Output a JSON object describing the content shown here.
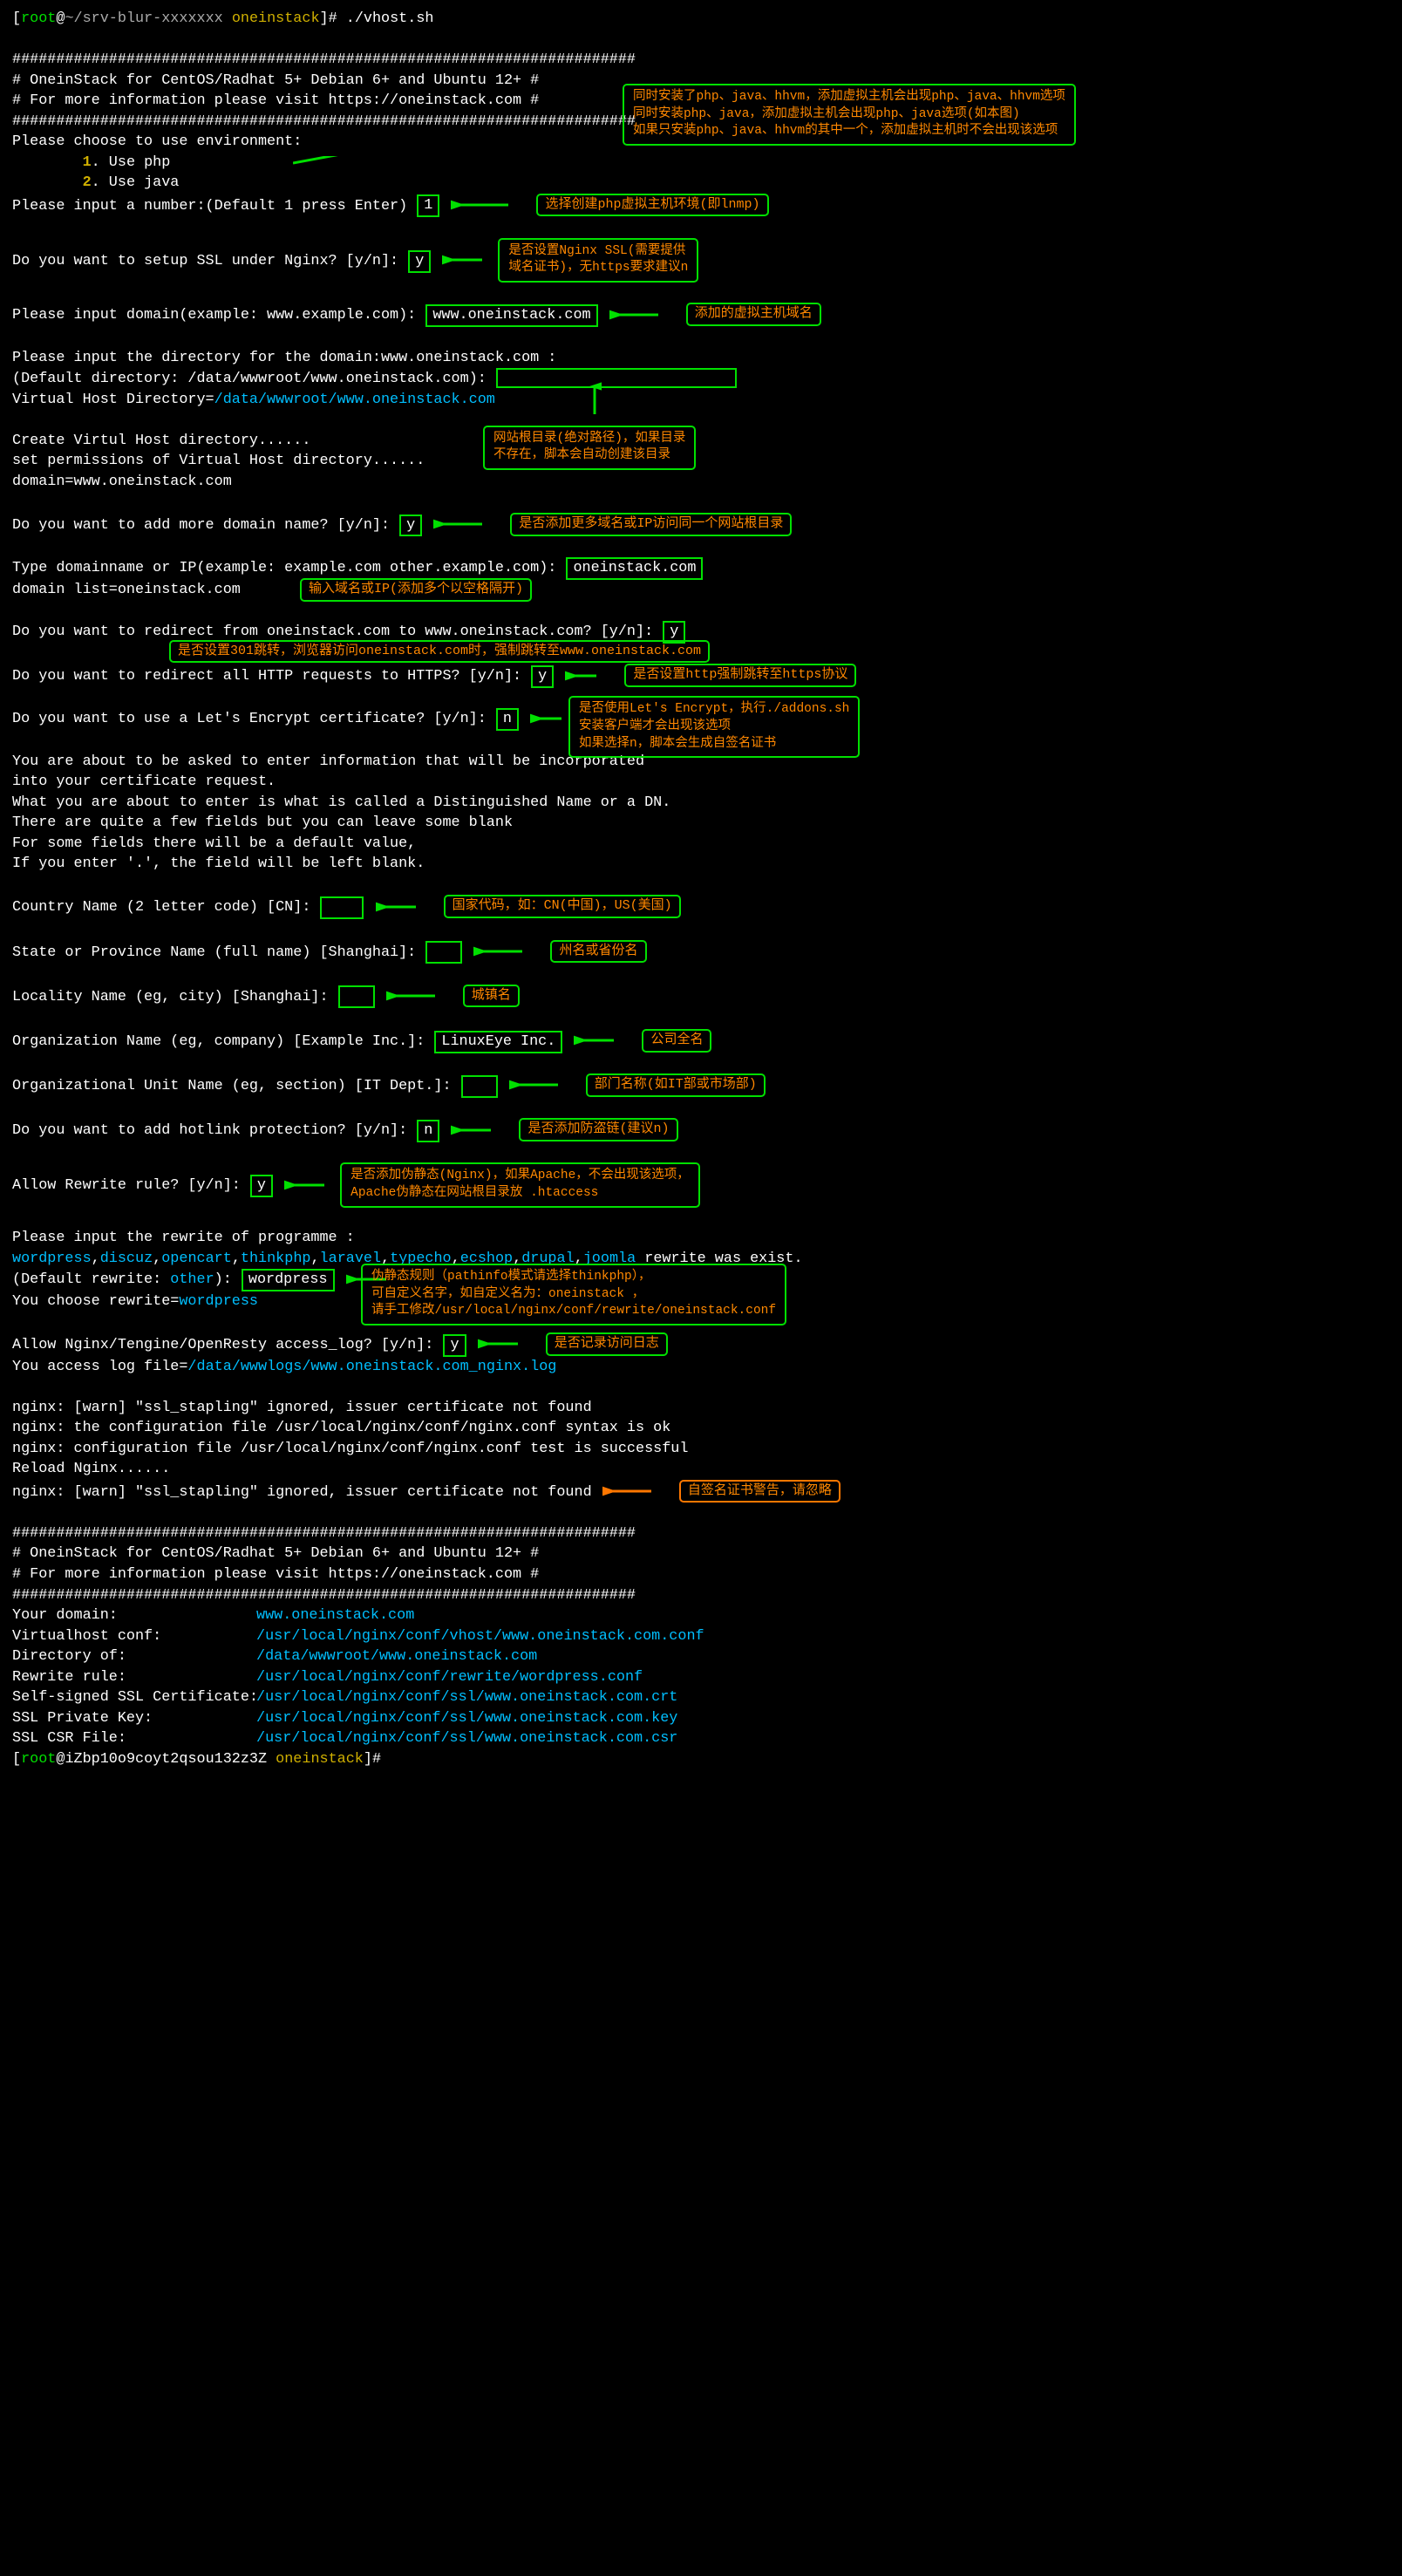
{
  "prompt1": {
    "user": "root",
    "at": "@",
    "host_blur": "~/srv-blur-xxxxxxx",
    "cwd": "oneinstack",
    "cmd": "./vhost.sh"
  },
  "hashline": "#######################################################################",
  "banner_line1": "#       OneinStack for CentOS/Radhat 5+ Debian 6+ and Ubuntu 12+      #",
  "banner_line2": "#       For more information please visit https://oneinstack.com      #",
  "env_prompt": "Please choose to use environment:",
  "env_opt1_num": "1",
  "env_opt1_label": ". Use php",
  "env_opt2_num": "2",
  "env_opt2_label": ". Use java",
  "annot_env_l1": "同时安装了php、java、hhvm，添加虚拟主机会出现php、java、hhvm选项",
  "annot_env_l2": "同时安装php、java，添加虚拟主机会出现php、java选项(如本图)",
  "annot_env_l3": "如果只安装php、java、hhvm的其中一个，添加虚拟主机时不会出现该选项",
  "num_prompt": "Please input a number:(Default 1 press Enter)",
  "num_value": "1",
  "annot_num": "选择创建php虚拟主机环境(即lnmp)",
  "ssl_prompt": "Do you want to setup SSL under Nginx? [y/n]:",
  "ssl_value": "y",
  "annot_ssl_l1": "是否设置Nginx SSL(需要提供",
  "annot_ssl_l2": "域名证书)，无https要求建议n",
  "domain_prompt": "Please input domain(example: www.example.com):",
  "domain_value": "www.oneinstack.com",
  "annot_domain": "添加的虚拟主机域名",
  "dir_prompt_l1": "Please input the directory for the domain:www.oneinstack.com :",
  "dir_prompt_l2_a": "(Default directory: ",
  "dir_prompt_l2_default": "/data/wwwroot/www.oneinstack.com",
  "dir_prompt_l2_b": "):",
  "dir_echo_a": "Virtual Host Directory=",
  "dir_echo_b": "/data/wwwroot/www.oneinstack.com",
  "annot_dir_l1": "网站根目录(绝对路径)，如果目录",
  "annot_dir_l2": "不存在，脚本会自动创建该目录",
  "create_l1": "Create Virtul Host directory......",
  "create_l2": "set permissions of Virtual Host directory......",
  "create_l3": "domain=www.oneinstack.com",
  "moredomain_prompt": "Do you want to add more domain name? [y/n]:",
  "moredomain_value": "y",
  "annot_moredomain": "是否添加更多域名或IP访问同一个网站根目录",
  "type_domain_prompt": "Type domainname or IP(example: example.com other.example.com):",
  "type_domain_value": "oneinstack.com",
  "domain_list": "domain list=oneinstack.com",
  "annot_type_domain": "输入域名或IP(添加多个以空格隔开)",
  "redirect_prompt": "Do you want to redirect from oneinstack.com to www.oneinstack.com? [y/n]:",
  "redirect_value": "y",
  "annot_redirect": "是否设置301跳转，浏览器访问oneinstack.com时，强制跳转至www.oneinstack.com",
  "https_prompt": "Do you want to redirect all HTTP requests to HTTPS? [y/n]:",
  "https_value": "y",
  "annot_https": "是否设置http强制跳转至https协议",
  "le_prompt": "Do you want to use a Let's Encrypt certificate? [y/n]:",
  "le_value": "n",
  "annot_le_l1": "是否使用Let's Encrypt，执行./addons.sh",
  "annot_le_l2": "安装客户端才会出现该选项",
  "annot_le_l3": "如果选择n，脚本会生成自签名证书",
  "csr_l1": "You are about to be asked to enter information that will be incorporated",
  "csr_l2": "into your certificate request.",
  "csr_l3": "What you are about to enter is what is called a Distinguished Name or a DN.",
  "csr_l4": "There are quite a few fields but you can leave some blank",
  "csr_l5": "For some fields there will be a default value,",
  "csr_l6": "If you enter '.', the field will be left blank.",
  "country_prompt": "Country Name (2 letter code) [CN]:",
  "annot_country": "国家代码，如：CN(中国)，US(美国)",
  "state_prompt": "State or Province Name (full name) [Shanghai]:",
  "annot_state": "州名或省份名",
  "locality_prompt": "Locality Name (eg, city) [Shanghai]:",
  "annot_locality": "城镇名",
  "org_prompt": "Organization Name (eg, company) [Example Inc.]:",
  "org_value": "LinuxEye Inc.",
  "annot_org": "公司全名",
  "ou_prompt": "Organizational Unit Name (eg, section) [IT Dept.]:",
  "annot_ou": "部门名称(如IT部或市场部)",
  "hotlink_prompt": "Do you want to add hotlink protection? [y/n]:",
  "hotlink_value": "n",
  "annot_hotlink": "是否添加防盗链(建议n)",
  "rewrite_prompt": "Allow Rewrite rule? [y/n]:",
  "rewrite_value": "y",
  "annot_rewrite_l1": "是否添加伪静态(Nginx)，如果Apache，不会出现该选项，",
  "annot_rewrite_l2": "Apache伪静态在网站根目录放 .htaccess",
  "rw_input_prompt": "Please input the rewrite of programme :",
  "rw_list_a": "wordpress",
  "rw_list_b": ",",
  "rw_list_c": "discuz",
  "rw_list_d": "opencart",
  "rw_list_e": "thinkphp",
  "rw_list_f": "laravel",
  "rw_list_g": "typecho",
  "rw_list_h": "ecshop",
  "rw_list_i": "drupal",
  "rw_list_j": "joomla",
  "rw_list_trail": " rewrite was exist.",
  "rw_default": "(Default rewrite: ",
  "rw_default_other": "other",
  "rw_default_close": "):",
  "rw_value": "wordpress",
  "rw_echo_a": "You choose rewrite=",
  "rw_echo_b": "wordpress",
  "annot_rw_l1": "伪静态规则（pathinfo模式请选择thinkphp），",
  "annot_rw_l2": "可自定义名字，如自定义名为：oneinstack ，",
  "annot_rw_l3": "请手工修改/usr/local/nginx/conf/rewrite/oneinstack.conf",
  "accesslog_prompt": "Allow Nginx/Tengine/OpenResty access_log? [y/n]:",
  "accesslog_value": "y",
  "annot_accesslog": "是否记录访问日志",
  "accesslog_echo_a": "You access log file=",
  "accesslog_echo_b": "/data/wwwlogs/www.oneinstack.com_nginx.log",
  "ngx_l1": "nginx: [warn] \"ssl_stapling\" ignored, issuer certificate not found",
  "ngx_l2": "nginx: the configuration file /usr/local/nginx/conf/nginx.conf syntax is ok",
  "ngx_l3": "nginx: configuration file /usr/local/nginx/conf/nginx.conf test is successful",
  "ngx_l4": "Reload Nginx......",
  "ngx_l5": "nginx: [warn] \"ssl_stapling\" ignored, issuer certificate not found",
  "annot_selfsign": "自签名证书警告，请忽略",
  "summary": {
    "k1": "Your domain:",
    "v1": "www.oneinstack.com",
    "k2": "Virtualhost conf:",
    "v2": "/usr/local/nginx/conf/vhost/www.oneinstack.com.conf",
    "k3": "Directory of:",
    "v3": "/data/wwwroot/www.oneinstack.com",
    "k4": "Rewrite rule:",
    "v4": "/usr/local/nginx/conf/rewrite/wordpress.conf",
    "k5": "Self-signed SSL Certificate:",
    "v5": "/usr/local/nginx/conf/ssl/www.oneinstack.com.crt",
    "k6": "SSL Private Key:",
    "v6": "/usr/local/nginx/conf/ssl/www.oneinstack.com.key",
    "k7": "SSL CSR File:",
    "v7": "/usr/local/nginx/conf/ssl/www.oneinstack.com.csr"
  },
  "prompt2": {
    "user": "root",
    "host": "iZbp10o9coyt2qsou132z3Z",
    "cwd": "oneinstack"
  }
}
